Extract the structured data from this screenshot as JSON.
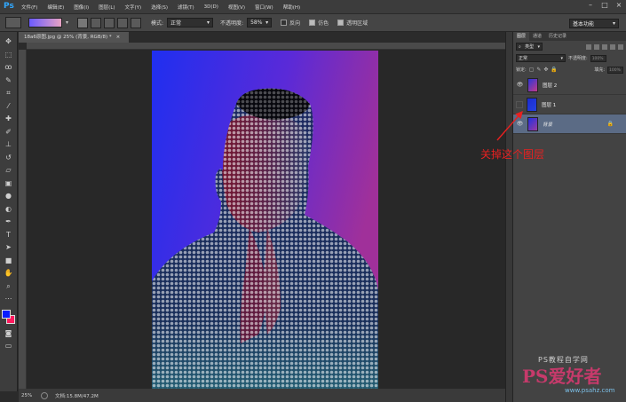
{
  "app": {
    "logo": "Ps"
  },
  "menu": [
    "文件(F)",
    "编辑(E)",
    "图像(I)",
    "图层(L)",
    "文字(Y)",
    "选择(S)",
    "滤镜(T)",
    "3D(D)",
    "视图(V)",
    "窗口(W)",
    "帮助(H)"
  ],
  "options": {
    "mode_label": "模式:",
    "mode_value": "正常",
    "opacity_label": "不透明度:",
    "opacity_value": "58%",
    "reverse_label": "反向",
    "dither_label": "仿色",
    "transparency_label": "透明区域",
    "workspace": "基本功能"
  },
  "document": {
    "tab_title": "18a6原图.jpg @ 25% (背景, RGB/8) *",
    "tab_close": "×"
  },
  "status": {
    "zoom": "25%",
    "doc_size": "文档:15.8M/47.2M"
  },
  "panel": {
    "tabs": [
      "图层",
      "通道",
      "历史记录"
    ],
    "filter_kind": "类型",
    "blend_mode": "正常",
    "opacity_label": "不透明度:",
    "opacity_value": "100%",
    "lock_label": "锁定:",
    "fill_label": "填充:",
    "fill_value": "100%",
    "layers": [
      {
        "name": "图层 2",
        "visible": true,
        "selected": false
      },
      {
        "name": "图层 1",
        "visible": false,
        "selected": false
      },
      {
        "name": "背景",
        "visible": true,
        "selected": true,
        "locked": true
      }
    ]
  },
  "annotation": {
    "text": "关掉这个图层",
    "color": "#e82020"
  },
  "watermark": {
    "small": "PS教程自学网",
    "big": "PS爱好者",
    "url": "www.psahz.com"
  },
  "colors": {
    "foreground": "#0a1cff",
    "background": "#ff1a5e",
    "accent_selected": "#5b6b85"
  }
}
